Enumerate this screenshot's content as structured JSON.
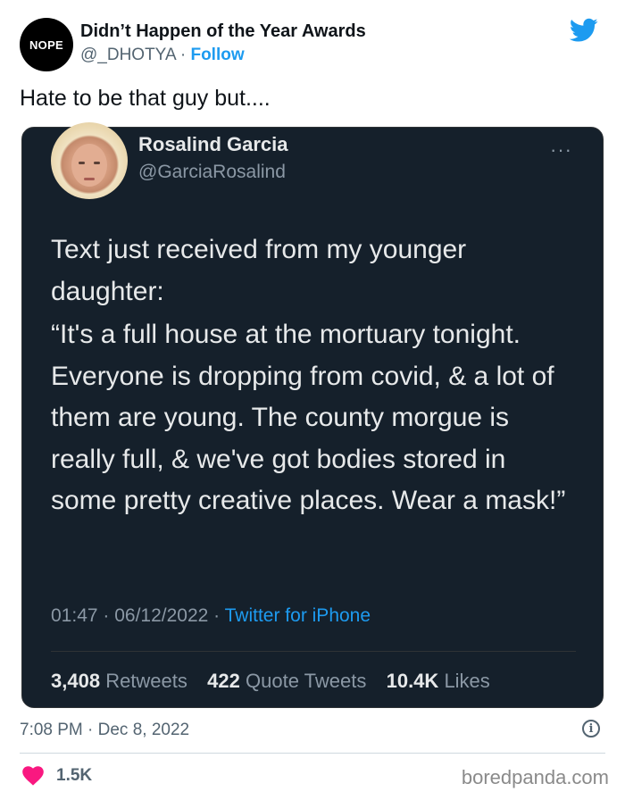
{
  "tweet": {
    "avatar_text": "NOPE",
    "display_name": "Didn’t Happen of the Year Awards",
    "handle": "@_DHOTYA",
    "separator": "·",
    "follow_label": "Follow",
    "text": "Hate to be that guy but....",
    "timestamp": "7:08 PM · Dec 8, 2022",
    "like_count": "1.5K",
    "brand_icon": "twitter-bird-icon",
    "colors": {
      "accent": "#1d9bf0",
      "like": "#f91880"
    }
  },
  "embedded": {
    "display_name": "Rosalind Garcia",
    "handle": "@GarciaRosalind",
    "more": "···",
    "text_line1": "Text just received from my younger daughter:",
    "text_quote": "“It's a full house at the mortuary tonight. Everyone is dropping from covid, & a lot of them are young. The county morgue is really full, & we've got bodies stored in some pretty creative places. Wear a mask!”",
    "meta_time": "01:47 · 06/12/2022 ·",
    "meta_source": "Twitter for iPhone",
    "retweets_count": "3,408",
    "retweets_label": "Retweets",
    "quotes_count": "422",
    "quotes_label": "Quote Tweets",
    "likes_count": "10.4K",
    "likes_label": "Likes",
    "colors": {
      "background": "#15202b",
      "text": "#e7e9ea",
      "muted": "#8b98a5"
    }
  },
  "watermark": "boredpanda.com"
}
